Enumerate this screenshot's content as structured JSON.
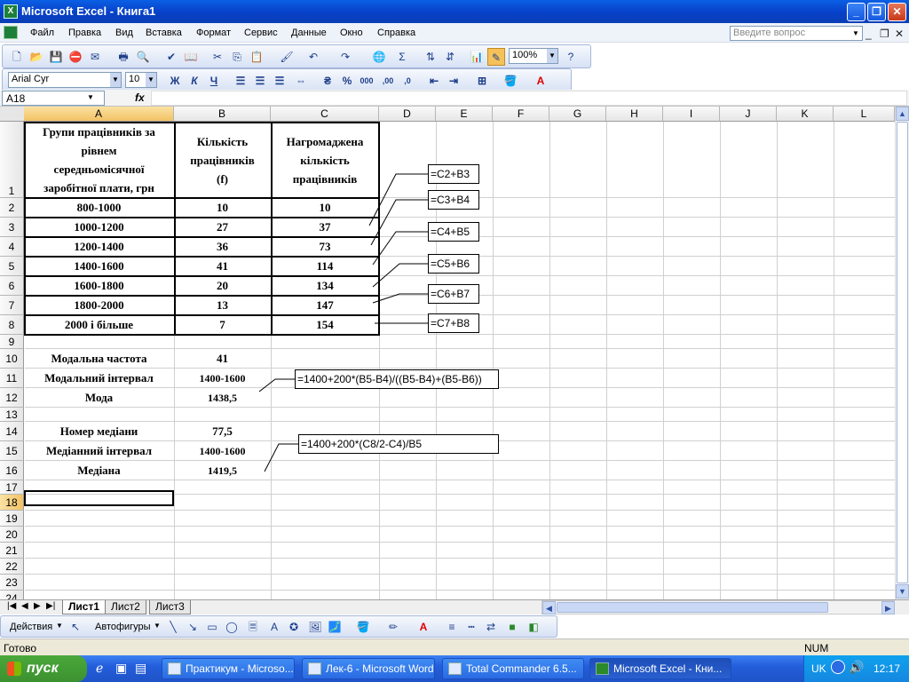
{
  "window": {
    "title": "Microsoft Excel - Книга1",
    "app_icon": "X"
  },
  "menu": [
    "Файл",
    "Правка",
    "Вид",
    "Вставка",
    "Формат",
    "Сервис",
    "Данные",
    "Окно",
    "Справка"
  ],
  "ask_placeholder": "Введите вопрос",
  "toolbar": {
    "zoom": "100%"
  },
  "format_bar": {
    "font": "Arial Cyr",
    "size": "10",
    "bold": "Ж",
    "italic": "К",
    "underline": "Ч"
  },
  "formula_bar": {
    "name_box": "A18",
    "fx": "fx",
    "value": ""
  },
  "columns": [
    "A",
    "B",
    "C",
    "D",
    "E",
    "F",
    "G",
    "H",
    "I",
    "J",
    "K",
    "L"
  ],
  "rows": [
    "1",
    "2",
    "3",
    "4",
    "5",
    "6",
    "7",
    "8",
    "9",
    "10",
    "11",
    "12",
    "13",
    "14",
    "15",
    "16",
    "17",
    "18",
    "19",
    "20",
    "21",
    "22",
    "23",
    "24"
  ],
  "selected_cell": "A18",
  "table": {
    "headers": [
      "Групи працівників за рівнем середньомісячної заробітної плати, грн",
      "Кількість працівників (f)",
      "Нагромаджена кількість працівників"
    ],
    "header_lines": [
      [
        "Групи працівників за",
        "рівнем",
        "середньомісячної",
        "заробітної плати, грн"
      ],
      [
        "Кількість",
        "працівників",
        "(f)"
      ],
      [
        "Нагромаджена",
        "кількість",
        "працівників"
      ]
    ],
    "rows": [
      [
        "800-1000",
        "10",
        "10"
      ],
      [
        "1000-1200",
        "27",
        "37"
      ],
      [
        "1200-1400",
        "36",
        "73"
      ],
      [
        "1400-1600",
        "41",
        "114"
      ],
      [
        "1600-1800",
        "20",
        "134"
      ],
      [
        "1800-2000",
        "13",
        "147"
      ],
      [
        "2000 і більше",
        "7",
        "154"
      ]
    ]
  },
  "stats": {
    "modal_freq_label": "Модальна частота",
    "modal_freq": "41",
    "modal_int_label": "Модальний інтервал",
    "modal_int": "1400-1600",
    "mode_label": "Мода",
    "mode": "1438,5",
    "median_num_label": "Номер медіани",
    "median_num": "77,5",
    "median_int_label": "Медіанний інтервал",
    "median_int": "1400-1600",
    "median_label": "Медіана",
    "median": "1419,5"
  },
  "callouts": {
    "c3": "=C2+B3",
    "c4": "=C3+B4",
    "c5": "=C4+B5",
    "c6": "=C5+B6",
    "c7": "=C6+B7",
    "c8": "=C7+B8",
    "mode": "=1400+200*(B5-B4)/((B5-B4)+(B5-B6))",
    "median": "=1400+200*(C8/2-C4)/B5"
  },
  "sheets": [
    "Лист1",
    "Лист2",
    "Лист3"
  ],
  "draw_bar": {
    "actions": "Действия",
    "autoshapes": "Автофигуры"
  },
  "status": {
    "ready": "Готово",
    "num": "NUM"
  },
  "taskbar": {
    "start": "пуск",
    "tasks": [
      "Практикум - Microso...",
      "Лек-6 - Microsoft Word",
      "Total Commander 6.5...",
      "Microsoft Excel - Кни..."
    ],
    "lang": "UK",
    "clock": "12:17"
  }
}
